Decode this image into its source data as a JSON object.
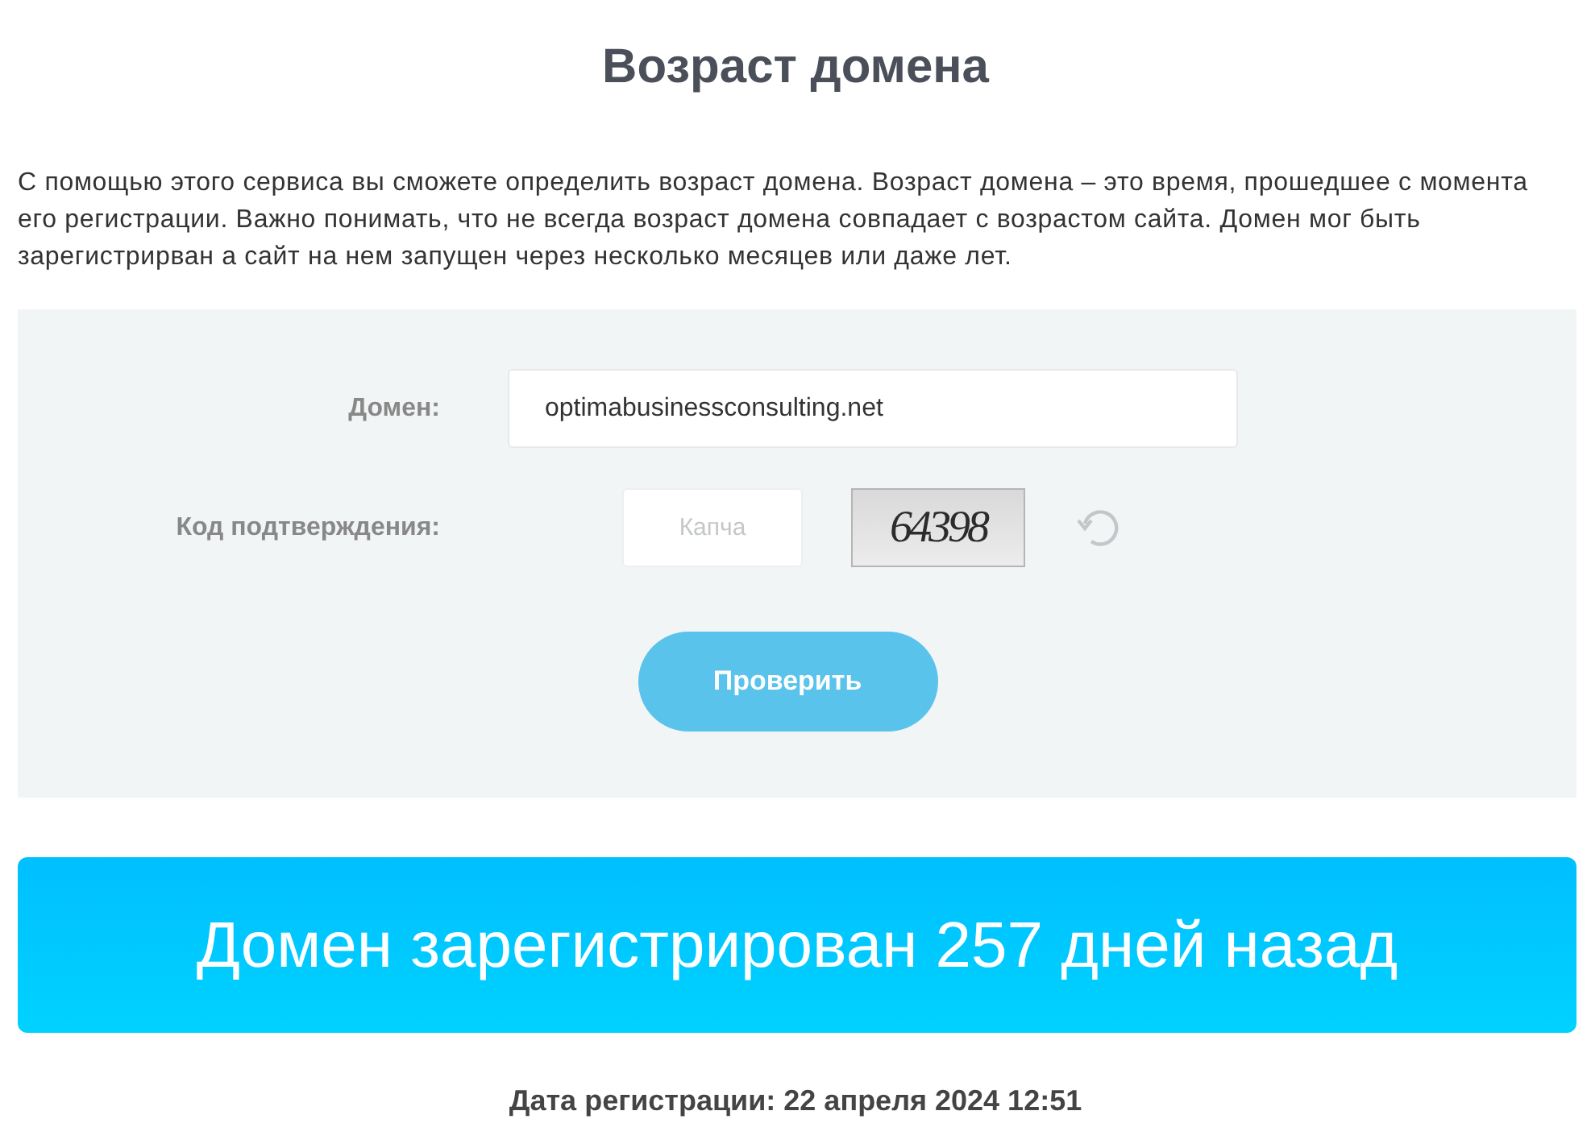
{
  "title": "Возраст домена",
  "description": "С помощью этого сервиса вы сможете определить возраст домена. Возраст домена – это время, прошедшее с момента его регистрации. Важно понимать, что не всегда возраст домена совпадает с возрастом сайта. Домен мог быть зарегистрирван а сайт на нем запущен через несколько месяцев или даже лет.",
  "form": {
    "domain": {
      "label": "Домен:",
      "value": "optimabusinessconsulting.net"
    },
    "captcha": {
      "label": "Код подтверждения:",
      "placeholder": "Капча",
      "code": "64398"
    },
    "submit": "Проверить"
  },
  "result": {
    "message": "Домен зарегистрирован 257 дней назад",
    "registration_date": "Дата регистрации: 22 апреля 2024 12:51"
  }
}
